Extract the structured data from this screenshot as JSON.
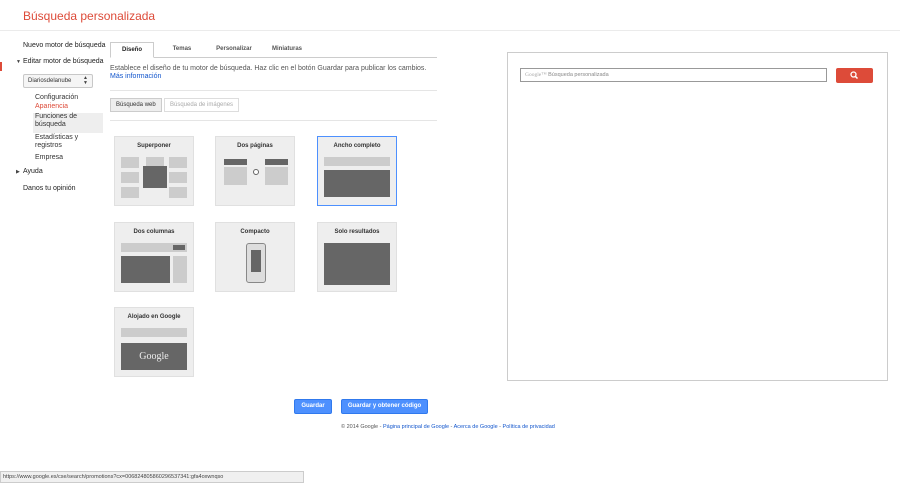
{
  "app": {
    "title": "Búsqueda personalizada"
  },
  "sidebar": {
    "new_engine": "Nuevo motor de búsqueda",
    "edit_engine": "Editar motor de búsqueda",
    "engine_name": "Diariosdelanube",
    "sub_items": {
      "configuracion": "Configuración",
      "apariencia": "Apariencia",
      "funciones": "Funciones de búsqueda",
      "estadisticas": "Estadísticas y registros",
      "empresa": "Empresa"
    },
    "ayuda": "Ayuda",
    "opinion": "Danos tu opinión"
  },
  "tabs": [
    "Diseño",
    "Temas",
    "Personalizar",
    "Miniaturas"
  ],
  "description": "Establece el diseño de tu motor de búsqueda. Haz clic en el botón Guardar para publicar los cambios.",
  "more_info": "Más información",
  "sub_tabs": [
    "Búsqueda web",
    "Búsqueda de imágenes"
  ],
  "layouts": [
    "Superponer",
    "Dos páginas",
    "Ancho completo",
    "Dos columnas",
    "Compacto",
    "Solo resultados",
    "Alojado en Google"
  ],
  "selected_layout": "Ancho completo",
  "google_logo_text": "Google",
  "buttons": {
    "save": "Guardar",
    "save_and_code": "Guardar y obtener código"
  },
  "footer": {
    "copyright": "© 2014 Google",
    "links": [
      "Página principal de Google",
      "Acerca de Google",
      "Política de privacidad"
    ]
  },
  "preview": {
    "google_label": "Google™",
    "placeholder": "Búsqueda personalizada"
  },
  "status_url": "https://www.google.es/cse/search/promotions?cx=006824805860296537341:gfa4oxwnqso",
  "colors": {
    "brand_red": "#dd4b39",
    "primary_blue": "#4d90fe",
    "link_blue": "#1155cc"
  }
}
